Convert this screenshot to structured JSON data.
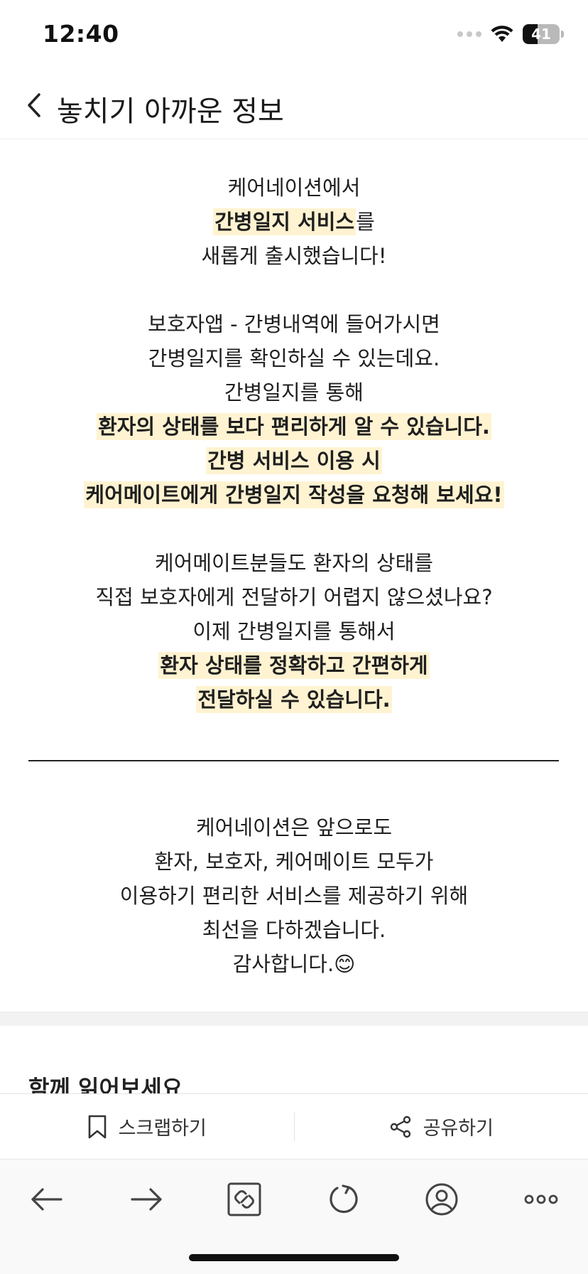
{
  "status_bar": {
    "time": "12:40",
    "battery": "41",
    "battery_level": 0.41,
    "icons": [
      "signal-dots-icon",
      "wifi-icon",
      "battery-icon"
    ]
  },
  "header": {
    "title": "놓치기 아까운 정보",
    "back_icon": "chevron-left-icon"
  },
  "article": {
    "p1": [
      {
        "segments": [
          {
            "text": "케어네이션에서",
            "hl": false
          }
        ]
      },
      {
        "segments": [
          {
            "text": "간병일지 서비스",
            "hl": true
          },
          {
            "text": "를",
            "hl": false
          }
        ]
      },
      {
        "segments": [
          {
            "text": "새롭게 출시했습니다!",
            "hl": false
          }
        ]
      }
    ],
    "p2": [
      {
        "segments": [
          {
            "text": "보호자앱 - 간병내역에 들어가시면",
            "hl": false
          }
        ]
      },
      {
        "segments": [
          {
            "text": "간병일지를 확인하실 수 있는데요.",
            "hl": false
          }
        ]
      },
      {
        "segments": [
          {
            "text": "간병일지를 통해",
            "hl": false
          }
        ]
      },
      {
        "segments": [
          {
            "text": "환자의 상태를 보다 편리하게 알 수 있습니다.",
            "hl": true
          }
        ]
      },
      {
        "segments": [
          {
            "text": "간병 서비스 이용 시",
            "hl": true
          }
        ]
      },
      {
        "segments": [
          {
            "text": "케어메이트에게 간병일지 작성을 요청해 보세요!",
            "hl": true
          }
        ]
      }
    ],
    "p3": [
      {
        "segments": [
          {
            "text": "케어메이트분들도 환자의 상태를",
            "hl": false
          }
        ]
      },
      {
        "segments": [
          {
            "text": "직접 보호자에게 전달하기 어렵지 않으셨나요?",
            "hl": false
          }
        ]
      },
      {
        "segments": [
          {
            "text": "이제 간병일지를 통해서",
            "hl": false
          }
        ]
      },
      {
        "segments": [
          {
            "text": "환자 상태를 정확하고 간편하게",
            "hl": true
          }
        ]
      },
      {
        "segments": [
          {
            "text": "전달하실 수 있습니다.",
            "hl": true
          }
        ]
      }
    ],
    "p4": [
      {
        "segments": [
          {
            "text": "케어네이션은 앞으로도",
            "hl": false
          }
        ]
      },
      {
        "segments": [
          {
            "text": "환자, 보호자, 케어메이트 모두가",
            "hl": false
          }
        ]
      },
      {
        "segments": [
          {
            "text": "이용하기 편리한 서비스를 제공하기 위해",
            "hl": false
          }
        ]
      },
      {
        "segments": [
          {
            "text": "최선을 다하겠습니다.",
            "hl": false
          }
        ]
      },
      {
        "segments": [
          {
            "text": "감사합니다.😊",
            "hl": false
          }
        ]
      }
    ]
  },
  "related": {
    "title": "함께 읽어보세요"
  },
  "actions": {
    "scrap_label": "스크랩하기",
    "scrap_icon": "bookmark-icon",
    "share_label": "공유하기",
    "share_icon": "share-icon"
  },
  "browser_toolbar": {
    "items": [
      "back-arrow-icon",
      "forward-arrow-icon",
      "link-icon",
      "refresh-icon",
      "profile-icon",
      "more-icon"
    ]
  },
  "colors": {
    "highlight": "#fff3d1",
    "text": "#1f1f1f"
  }
}
